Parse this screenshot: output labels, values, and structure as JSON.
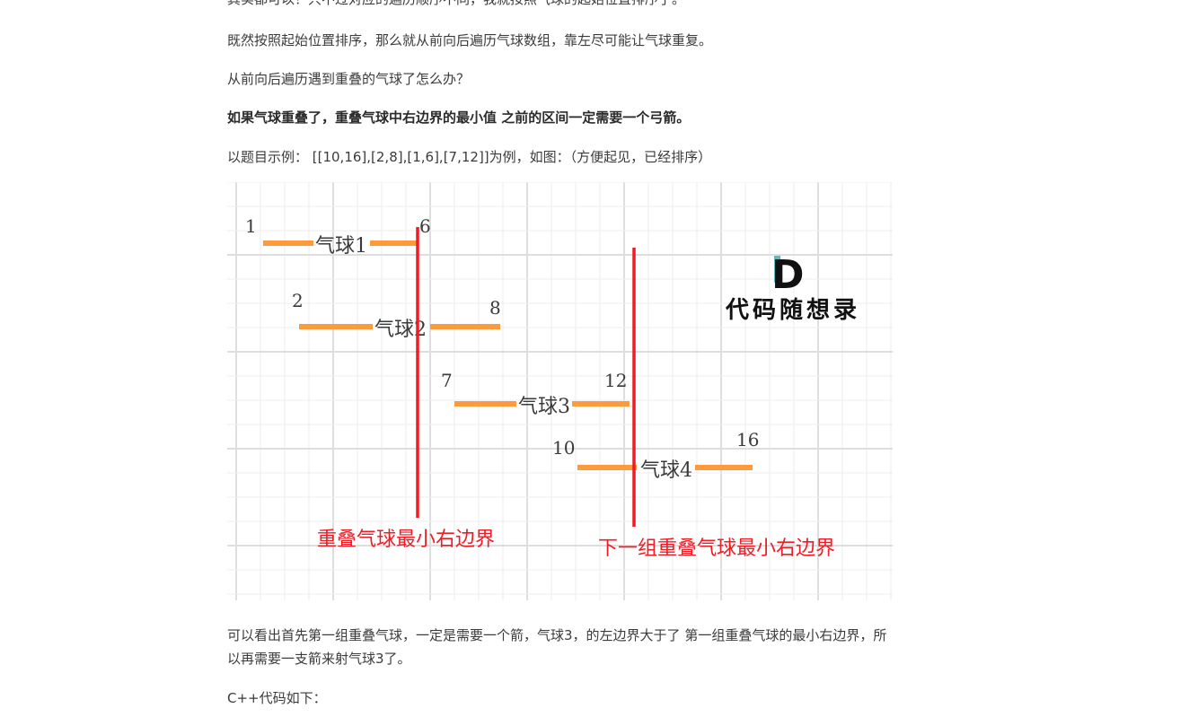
{
  "article": {
    "cut_top_text": "其实都可以！只不过对应的遍历顺序不同，我就按照气球的起始位置排序了。",
    "para_sort": "既然按照起始位置排序，那么就从前向后遍历气球数组，靠左尽可能让气球重复。",
    "para_question": "从前向后遍历遇到重叠的气球了怎么办？",
    "para_bold": "如果气球重叠了，重叠气球中右边界的最小值 之前的区间一定需要一个弓箭。",
    "para_example": "以题目示例： [[10,16],[2,8],[1,6],[7,12]]为例，如图：（方便起见，已经排序）",
    "para_explain": "可以看出首先第一组重叠气球，一定是需要一个箭，气球3，的左边界大于了 第一组重叠气球的最小右边界，所以再需要一支箭来射气球3了。",
    "para_code": "C++代码如下："
  },
  "figure": {
    "balloons": [
      {
        "label": "气球1",
        "start": 1,
        "end": 6,
        "start_text": "1",
        "end_text": "6"
      },
      {
        "label": "气球2",
        "start": 2,
        "end": 8,
        "start_text": "2",
        "end_text": "8"
      },
      {
        "label": "气球3",
        "start": 7,
        "end": 12,
        "start_text": "7",
        "end_text": "12"
      },
      {
        "label": "气球4",
        "start": 10,
        "end": 16,
        "start_text": "10",
        "end_text": "16"
      }
    ],
    "arrow1_label": "重叠气球最小右边界",
    "arrow2_label": "下一组重叠气球最小右边界",
    "logo_letter": "D",
    "logo_text": "代码随想录",
    "colors": {
      "balloon": "#ff9a3c",
      "arrow": "#ee1c25",
      "label_text": "#3a3a3a",
      "grid": "#e8e8e8",
      "logo_teal": "#5fb8c2"
    }
  }
}
